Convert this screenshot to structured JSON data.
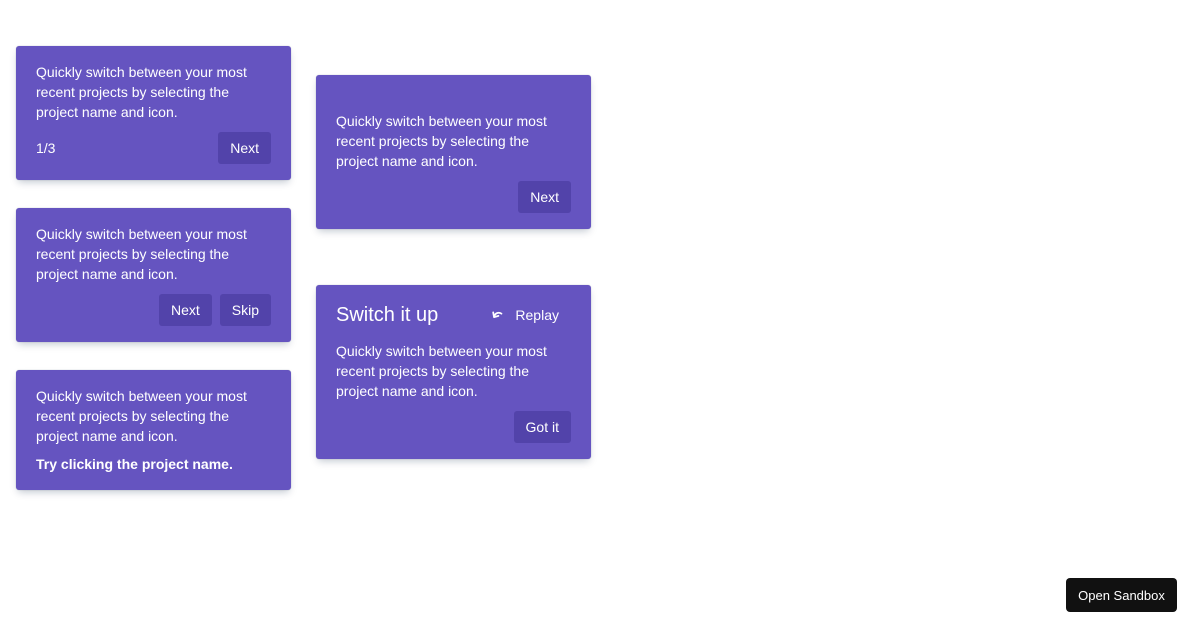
{
  "cards": {
    "step_card": {
      "body": "Quickly switch between your most recent projects by selecting the project name and icon.",
      "step": "1/3",
      "next_label": "Next"
    },
    "skip_card": {
      "body": "Quickly switch between your most recent projects by selecting the project name and icon.",
      "next_label": "Next",
      "skip_label": "Skip"
    },
    "hint_card": {
      "body": "Quickly switch between your most recent projects by selecting the project name and icon.",
      "hint": "Try clicking the project name."
    },
    "simple_card": {
      "body": "Quickly switch between your most recent projects by selecting the project name and icon.",
      "next_label": "Next"
    },
    "heading_card": {
      "heading": "Switch it up",
      "replay_label": "Replay",
      "body": "Quickly switch between your most recent projects by selecting the project name and icon.",
      "got_it_label": "Got it"
    }
  },
  "sandbox": {
    "label": "Open Sandbox"
  },
  "colors": {
    "card_background": "#6554c0",
    "button_background": "#5243aa",
    "text": "#ffffff",
    "sandbox_background": "#111111"
  },
  "icons": {
    "replay": "undo-arrow-icon"
  }
}
